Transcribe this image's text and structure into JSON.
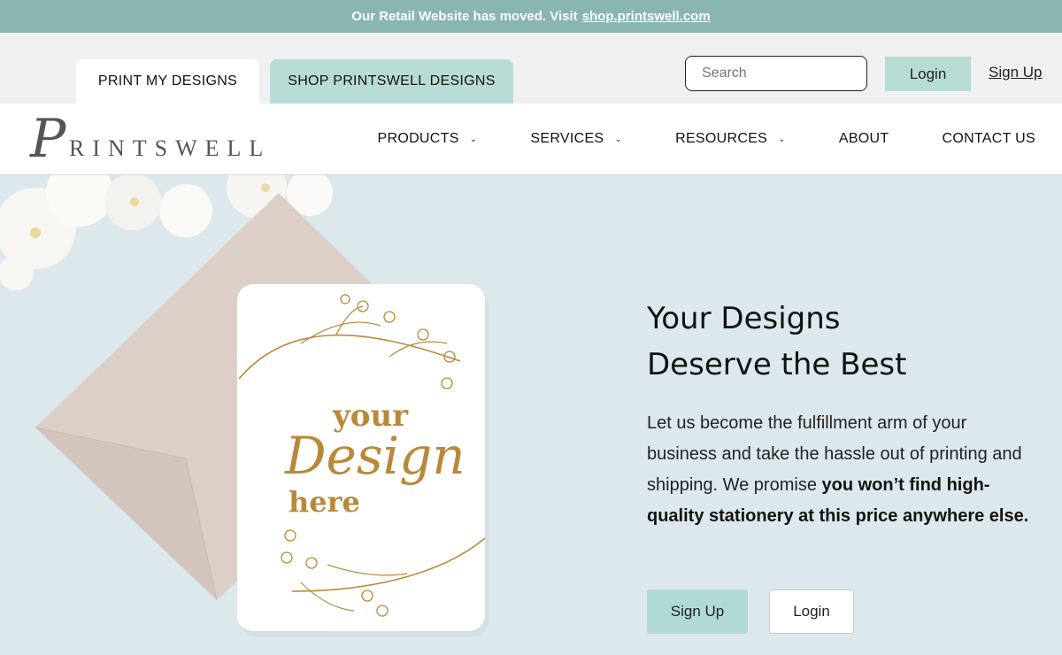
{
  "announcement": {
    "text": "Our Retail Website has moved. Visit",
    "link": "shop.printswell.com"
  },
  "topbar": {
    "tabs": [
      {
        "label": "PRINT MY DESIGNS"
      },
      {
        "label": "SHOP PRINTSWELL DESIGNS"
      }
    ],
    "search_placeholder": "Search",
    "login_label": "Login",
    "signup_label": "Sign Up"
  },
  "logo": {
    "mark": "P",
    "word": "RINTSWELL"
  },
  "nav": {
    "items": [
      {
        "label": "PRODUCTS",
        "has_dropdown": true
      },
      {
        "label": "SERVICES",
        "has_dropdown": true
      },
      {
        "label": "RESOURCES",
        "has_dropdown": true
      },
      {
        "label": "ABOUT",
        "has_dropdown": false
      },
      {
        "label": "CONTACT US",
        "has_dropdown": false
      }
    ],
    "chevron_icon": "chevron-down-icon"
  },
  "hero": {
    "card_text": {
      "line1": "your",
      "line2": "Design",
      "line3": "here"
    },
    "headline_line1": "Your Designs",
    "headline_line2": "Deserve the Best",
    "body_plain": "Let us become the fulfillment arm of your business and take the hassle out of printing and shipping. We promise ",
    "body_bold": "you won’t find high-quality stationery at this price anywhere else.",
    "signup_label": "Sign Up",
    "login_label": "Login"
  },
  "colors": {
    "announcement_bg": "#89b6ae",
    "accent_teal": "#b7dcd6",
    "hero_bg": "#dde8ed",
    "gold": "#b8893a",
    "envelope": "#dccfc8"
  }
}
